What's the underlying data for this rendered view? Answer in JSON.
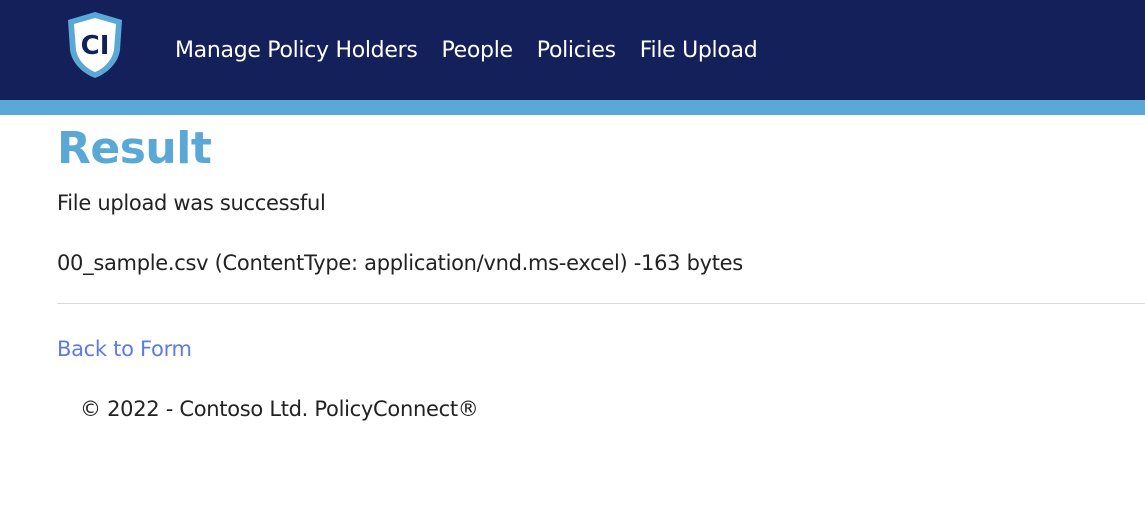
{
  "header": {
    "logo_text": "CI",
    "nav": [
      {
        "label": "Manage Policy Holders"
      },
      {
        "label": "People"
      },
      {
        "label": "Policies"
      },
      {
        "label": "File Upload"
      }
    ],
    "colors": {
      "bar": "#13205a",
      "accent": "#5aa8d6"
    }
  },
  "main": {
    "title": "Result",
    "message": "File upload was successful",
    "file_info": "00_sample.csv (ContentType: application/vnd.ms-excel) -163 bytes",
    "back_link": "Back to Form",
    "link_color": "#5d7ce3"
  },
  "footer": {
    "text": "© 2022 - Contoso Ltd. PolicyConnect®"
  }
}
